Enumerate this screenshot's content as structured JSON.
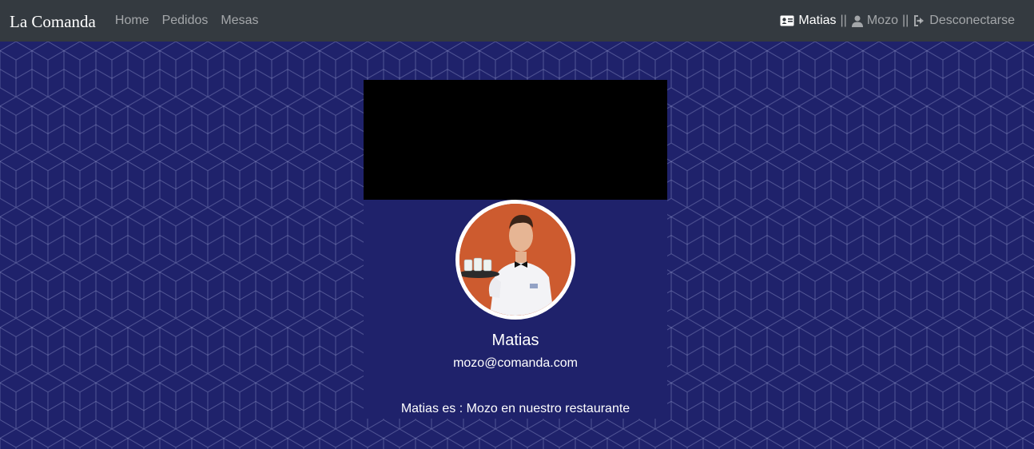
{
  "navbar": {
    "brand": "La Comanda",
    "links": [
      "Home",
      "Pedidos",
      "Mesas"
    ],
    "user": {
      "name": "Matias",
      "role": "Mozo",
      "logout": "Desconectarse",
      "separator": "||",
      "user_icon": "id-card-icon",
      "role_icon": "user-icon",
      "logout_icon": "sign-out-icon"
    }
  },
  "profile": {
    "name": "Matias",
    "email": "mozo@comanda.com",
    "description": "Matias es : Mozo en nuestro restaurante"
  },
  "colors": {
    "navbar_bg": "#343a40",
    "page_bg": "#1f226b",
    "cover_bg": "#000000"
  }
}
